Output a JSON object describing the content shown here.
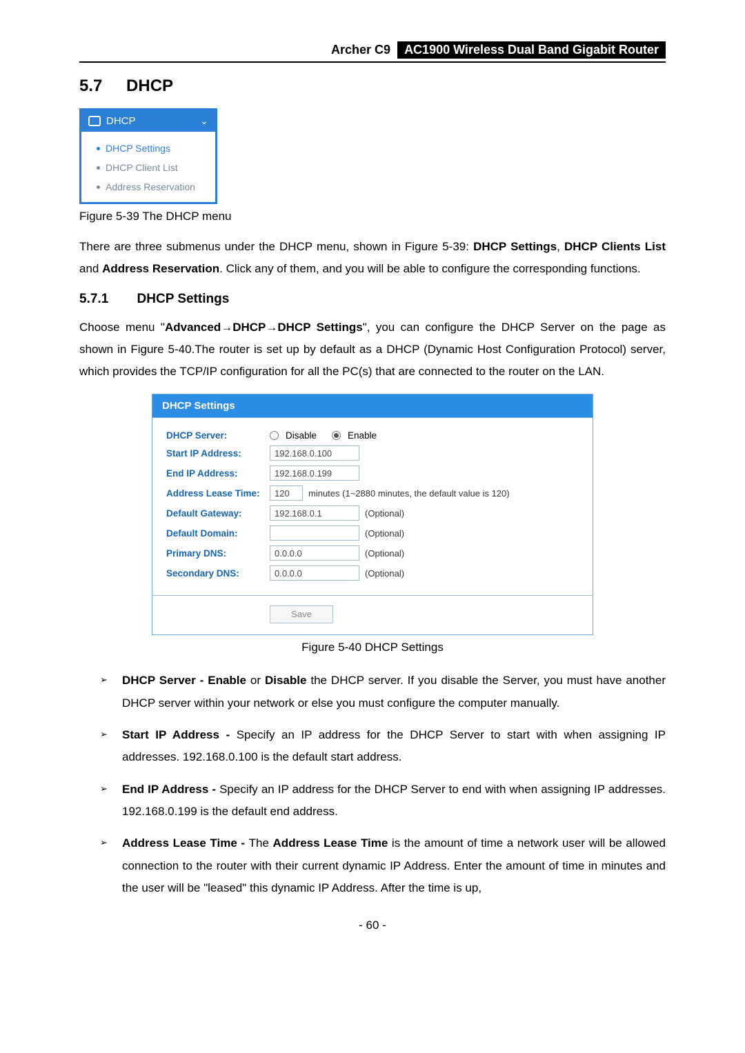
{
  "header": {
    "model": "Archer C9",
    "product": "AC1900 Wireless Dual Band Gigabit Router"
  },
  "section": {
    "number": "5.7",
    "title": "DHCP"
  },
  "menu": {
    "title": "DHCP",
    "items": [
      {
        "label": "DHCP Settings"
      },
      {
        "label": "DHCP Client List"
      },
      {
        "label": "Address Reservation"
      }
    ]
  },
  "fig39_caption": "Figure 5-39 The DHCP menu",
  "para1_a": "There are three submenus under the DHCP menu, shown in Figure 5-39: ",
  "para1_b1": "DHCP Settings",
  "para1_c": ", ",
  "para1_b2": "DHCP Clients List",
  "para1_d": " and ",
  "para1_b3": "Address Reservation",
  "para1_e": ". Click any of them, and you will be able to configure the corresponding functions.",
  "subsection": {
    "number": "5.7.1",
    "title": "DHCP Settings"
  },
  "para2_a": "Choose menu \"",
  "para2_b1": "Advanced",
  "para2_arrow": "→",
  "para2_b2": "DHCP",
  "para2_b3": "DHCP Settings",
  "para2_c": "\", you can configure the DHCP Server on the page as shown in Figure 5-40.The router is set up by default as a DHCP (Dynamic Host Configuration Protocol) server, which provides the TCP/IP configuration for all the PC(s) that are connected to the router on the LAN.",
  "panel": {
    "title": "DHCP Settings",
    "server_label": "DHCP Server:",
    "server_disable": "Disable",
    "server_enable": "Enable",
    "start_label": "Start IP Address:",
    "start_value": "192.168.0.100",
    "end_label": "End IP Address:",
    "end_value": "192.168.0.199",
    "lease_label": "Address Lease Time:",
    "lease_value": "120",
    "lease_hint": "minutes (1~2880 minutes, the default value is 120)",
    "gw_label": "Default Gateway:",
    "gw_value": "192.168.0.1",
    "optional": "(Optional)",
    "domain_label": "Default Domain:",
    "domain_value": "",
    "pdns_label": "Primary DNS:",
    "pdns_value": "0.0.0.0",
    "sdns_label": "Secondary DNS:",
    "sdns_value": "0.0.0.0",
    "save": "Save"
  },
  "fig40_caption": "Figure 5-40 DHCP Settings",
  "bullets": [
    {
      "h": "DHCP Server - ",
      "b1": "Enable",
      "m": " or ",
      "b2": "Disable",
      "t": " the DHCP server. If you disable the Server, you must have another DHCP server within your network or else you must configure the computer manually."
    },
    {
      "h": "Start IP Address - ",
      "t": "Specify an IP address for the DHCP Server to start with when assigning IP addresses. 192.168.0.100 is the default start address."
    },
    {
      "h": "End IP Address - ",
      "t": "Specify an IP address for the DHCP Server to end with when assigning IP addresses. 192.168.0.199 is the default end address."
    },
    {
      "h": "Address Lease Time - ",
      "m": "The ",
      "b1": "Address Lease Time",
      "t": " is the amount of time a network user will be allowed connection to the router with their current dynamic IP Address. Enter the amount of time in minutes and the user will be \"leased\" this dynamic IP Address. After the time is up,"
    }
  ],
  "page_number": "- 60 -"
}
